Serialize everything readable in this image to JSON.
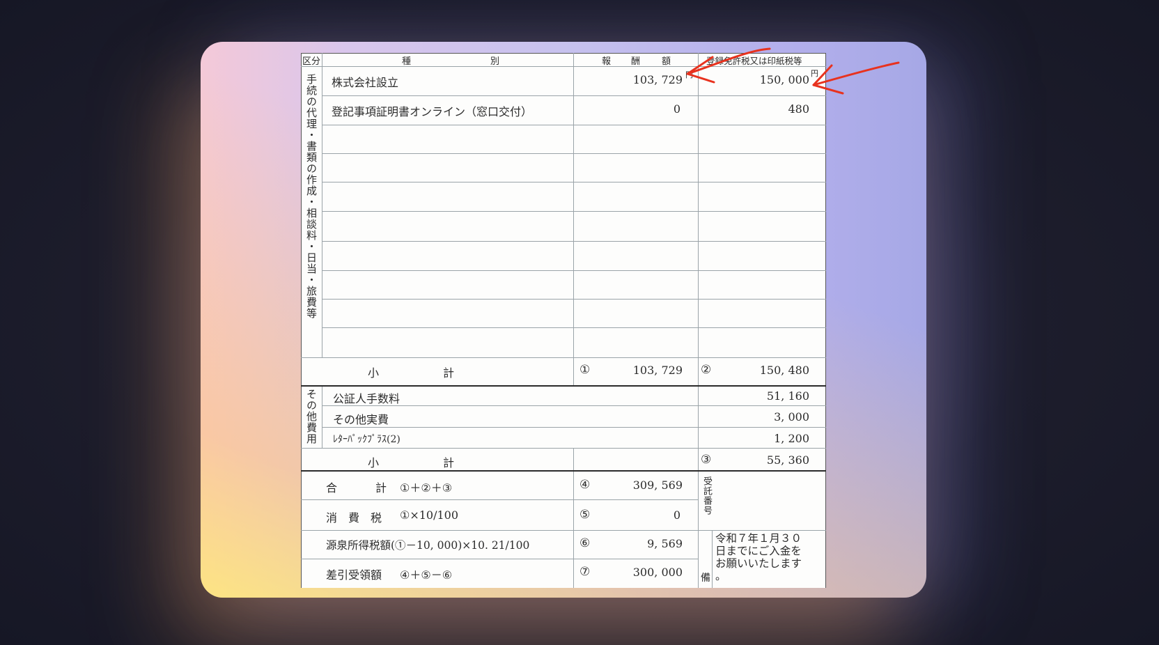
{
  "header": {
    "kubun": "区分",
    "shubetsu_1": "種",
    "shubetsu_2": "別",
    "hoshu_1": "報",
    "hoshu_2": "酬",
    "hoshu_3": "額",
    "tax": "登録免許税又は印紙税等",
    "yen": "円",
    "yen2": "円"
  },
  "section1": {
    "label": "手続の代理・書類の作成・相談料・日当・旅費等",
    "rows": [
      {
        "item": "株式会社設立",
        "fee": "103, 729",
        "tax": "150, 000"
      },
      {
        "item": "登記事項証明書オンライン（窓口交付）",
        "fee": "0",
        "tax": "480"
      }
    ],
    "subtotal_label_1": "小",
    "subtotal_label_2": "計",
    "subtotal_fee_mark": "①",
    "subtotal_fee": "103, 729",
    "subtotal_tax_mark": "②",
    "subtotal_tax": "150, 480"
  },
  "section2": {
    "label": "その他費用",
    "rows": [
      {
        "item": "公証人手数料",
        "amount": "51, 160"
      },
      {
        "item": "その他実費",
        "amount": "3, 000"
      },
      {
        "item": "ﾚﾀｰﾊﾟｯｸﾌﾟﾗｽ(2)",
        "amount": "1, 200"
      }
    ],
    "subtotal_label_1": "小",
    "subtotal_label_2": "計",
    "subtotal_mark": "③",
    "subtotal": "55, 360"
  },
  "totals": [
    {
      "label_a": "合",
      "label_b": "計",
      "formula": "①＋②＋③",
      "mark": "④",
      "value": "309, 569"
    },
    {
      "label_a": "消　費　税",
      "label_b": "",
      "formula": "①×10/100",
      "mark": "⑤",
      "value": "0"
    },
    {
      "label_a": "源泉所得税額(①－10, 000)×10. 21/100",
      "label_b": "",
      "formula": "",
      "mark": "⑥",
      "value": "9, 569"
    },
    {
      "label_a": "差引受領額",
      "label_b": "",
      "formula": "④＋⑤－⑥",
      "mark": "⑦",
      "value": "300, 000"
    }
  ],
  "side": {
    "juitaku": "受託番号",
    "biko": "備",
    "note_1": "令和７年１月３０",
    "note_2": "日までにご入金を",
    "note_3": "お願いいたします",
    "note_4": "。"
  },
  "colors": {
    "arrow": "#e8321e",
    "line": "#9aa3a8"
  }
}
